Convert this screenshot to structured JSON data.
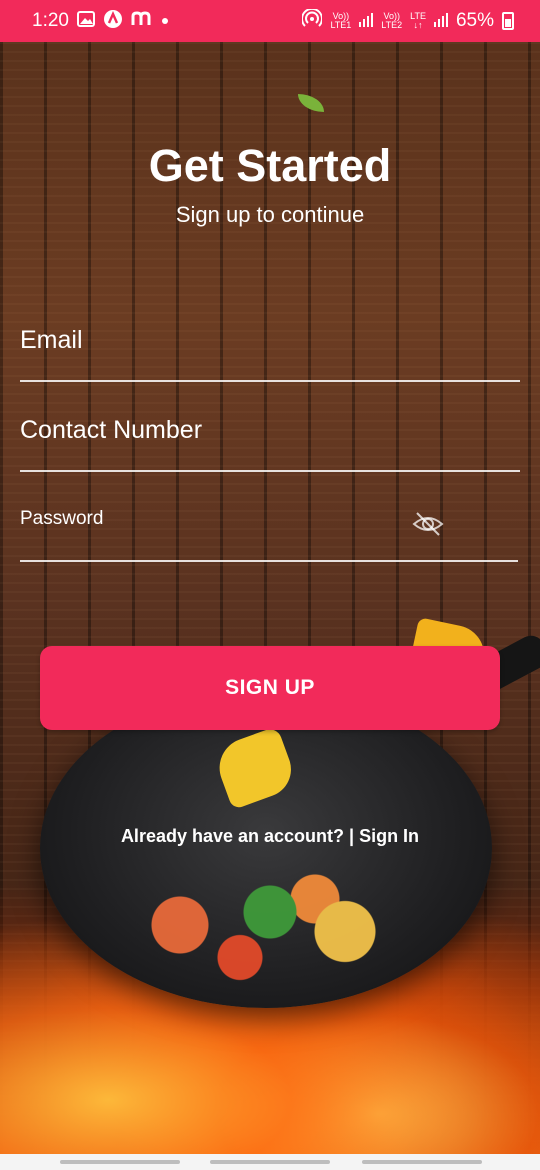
{
  "status_bar": {
    "time": "1:20",
    "net1_top": "Vo))",
    "net1_bottom": "LTE1",
    "net2_top": "Vo))",
    "net2_bottom": "LTE2",
    "net3_top": "LTE",
    "net3_bottom": "↓↑",
    "battery_text": "65%"
  },
  "header": {
    "title": "Get Started",
    "subtitle": "Sign up to continue"
  },
  "form": {
    "email_label": "Email",
    "contact_label": "Contact Number",
    "password_label": "Password",
    "password_visibility": "hidden"
  },
  "actions": {
    "signup_label": "SIGN UP",
    "signin_prompt": "Already have an account? | ",
    "signin_link": "Sign In"
  },
  "colors": {
    "accent": "#f22a5a",
    "text": "#ffffff"
  },
  "icons": [
    "image-icon",
    "app-a-icon",
    "app-m-icon",
    "hotspot-icon",
    "signal-icon",
    "battery-icon",
    "eye-off-icon"
  ]
}
